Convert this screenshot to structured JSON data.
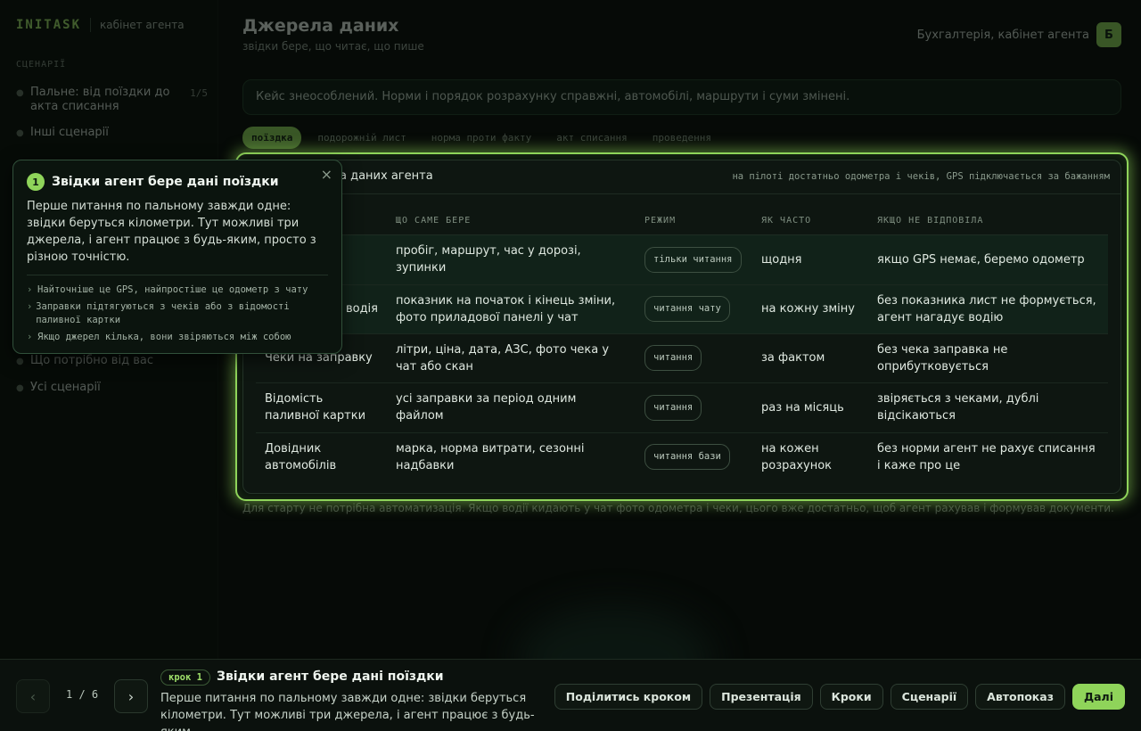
{
  "sidebar": {
    "brand": "INITASK",
    "brand_sub": "кабінет агента",
    "section_label": "СЦЕНАРІЇ",
    "items": [
      {
        "label": "Пальне: від поїздки до акта списання",
        "count": "1/5"
      },
      {
        "label": "Інші сценарії"
      },
      {
        "label": "Що потрібно від вас"
      },
      {
        "label": "Усі сценарії"
      }
    ]
  },
  "header": {
    "title": "Джерела даних",
    "subtitle": "звідки бере, що читає, що пише",
    "user_name": "Бухгалтерія, кабінет агента",
    "user_initial": "Б"
  },
  "notice": "Кейс знеособлений. Норми і порядок розрахунку справжні, автомобілі, маршрути і суми змінені.",
  "tabs": [
    "поїздка",
    "подорожній лист",
    "норма проти факту",
    "акт списання",
    "проведення"
  ],
  "panel": {
    "title": "а даних агента",
    "note": "на пілоті достатньо одометра і чеків, GPS підключається за бажанням",
    "columns": [
      "",
      "ЩО САМЕ БЕРЕ",
      "РЕЖИМ",
      "ЯК ЧАСТО",
      "ЯКЩО НЕ ВІДПОВІЛА"
    ],
    "rows": [
      {
        "source": "",
        "what": "пробіг, маршрут, час у дорозі, зупинки",
        "mode": "тільки читання",
        "freq": "щодня",
        "fallback": "якщо GPS немає, беремо одометр"
      },
      {
        "source": "водія",
        "what": "показник на початок і кінець зміни, фото приладової панелі у чат",
        "mode": "читання чату",
        "freq": "на кожну зміну",
        "fallback": "без показника лист не формується, агент нагадує водію"
      },
      {
        "source": "Чеки на заправку",
        "what": "літри, ціна, дата, АЗС, фото чека у чат або скан",
        "mode": "читання",
        "freq": "за фактом",
        "fallback": "без чека заправка не оприбутковується"
      },
      {
        "source": "Відомість паливної картки",
        "what": "усі заправки за період одним файлом",
        "mode": "читання",
        "freq": "раз на місяць",
        "fallback": "звіряється з чеками, дублі відсікаються"
      },
      {
        "source": "Довідник автомобілів",
        "what": "марка, норма витрати, сезонні надбавки",
        "mode": "читання бази",
        "freq": "на кожен розрахунок",
        "fallback": "без норми агент не рахує списання і каже про це"
      }
    ]
  },
  "footnote": "Для старту не потрібна автоматизація. Якщо водії кидають у чат фото одометра і чеки, цього вже достатньо, щоб агент рахував і формував документи.",
  "callout": {
    "step": "1",
    "title": "Звідки агент бере дані поїздки",
    "body": "Перше питання по пальному завжди одне: звідки беруться кілометри. Тут можливі три джерела, і агент працює з будь-яким, просто з різною точністю.",
    "bullets": [
      "Найточніше це GPS, найпростіше це одометр з чату",
      "Заправки підтягуються з чеків або з відомості паливної картки",
      "Якщо джерел кілька, вони звіряються між собою"
    ],
    "close": "×"
  },
  "tour": {
    "prev": "‹",
    "next": "›",
    "counter": "1 / 6",
    "step_tag": "крок 1",
    "title": "Звідки агент бере дані поїздки",
    "desc": "Перше питання по пальному завжди одне: звідки беруться кілометри. Тут можливі три джерела, і агент працює з будь-яким...",
    "actions": [
      "Поділитись кроком",
      "Презентація",
      "Кроки",
      "Сценарії",
      "Автопоказ"
    ],
    "primary": "Далі"
  },
  "colors": {
    "accent": "#8fd45a",
    "background": "#060a07"
  }
}
